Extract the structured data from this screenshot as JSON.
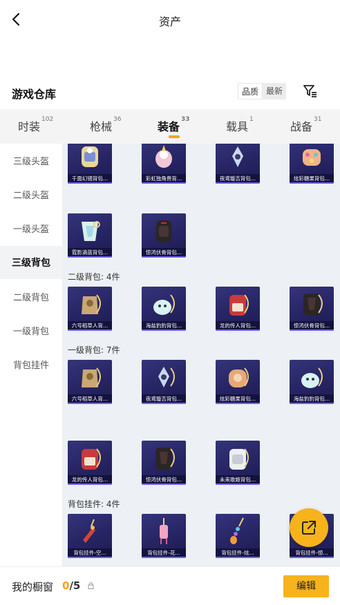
{
  "header": {
    "title": "资产"
  },
  "warehouse": {
    "title": "游戏仓库",
    "sort": [
      "品质",
      "最新"
    ]
  },
  "tabs": [
    {
      "label": "时装",
      "count": "102"
    },
    {
      "label": "枪械",
      "count": "36"
    },
    {
      "label": "装备",
      "count": "33"
    },
    {
      "label": "载具",
      "count": "1"
    },
    {
      "label": "战备",
      "count": "31"
    }
  ],
  "sidebar": {
    "items": [
      "三级头盔",
      "二级头盔",
      "一级头盔",
      "三级背包",
      "二级背包",
      "一级背包",
      "背包挂件"
    ]
  },
  "content": {
    "row_top": [
      "千面幻镜背包...",
      "彩虹独角兽背...",
      "夜鸢璇吉背包...",
      "炫彩糖果背包..."
    ],
    "row_level3_b": [
      "霓影滴蓝背包...",
      "惊鸿伏骨背包..."
    ],
    "level2_label": "二级背包: 4件",
    "level2": [
      "六号稻草人背...",
      "海盐豹豹背包...",
      "龙的传人背包...",
      "惊鸿伏骨背包..."
    ],
    "level1_label": "一级背包: 7件",
    "level1_a": [
      "六号稻草人背...",
      "夜鸢璇吉背包...",
      "炫彩糖果背包...",
      "海盐豹豹背包..."
    ],
    "level1_b": [
      "龙的传人背包...",
      "惊鸿伏骨背包...",
      "未来歌姬背包..."
    ],
    "pendant_label": "背包挂件: 4件",
    "pendant": [
      "背包挂件-空...",
      "背包挂件-花...",
      "背包挂件-炫...",
      "背包挂件-惊..."
    ]
  },
  "bottom": {
    "label": "我的橱窗",
    "current": "0",
    "total": "/5",
    "edit": "编辑"
  },
  "colors": {
    "accent": "#f6b31c",
    "tile_bg": "#262463",
    "content_bg": "#edf0f4"
  }
}
